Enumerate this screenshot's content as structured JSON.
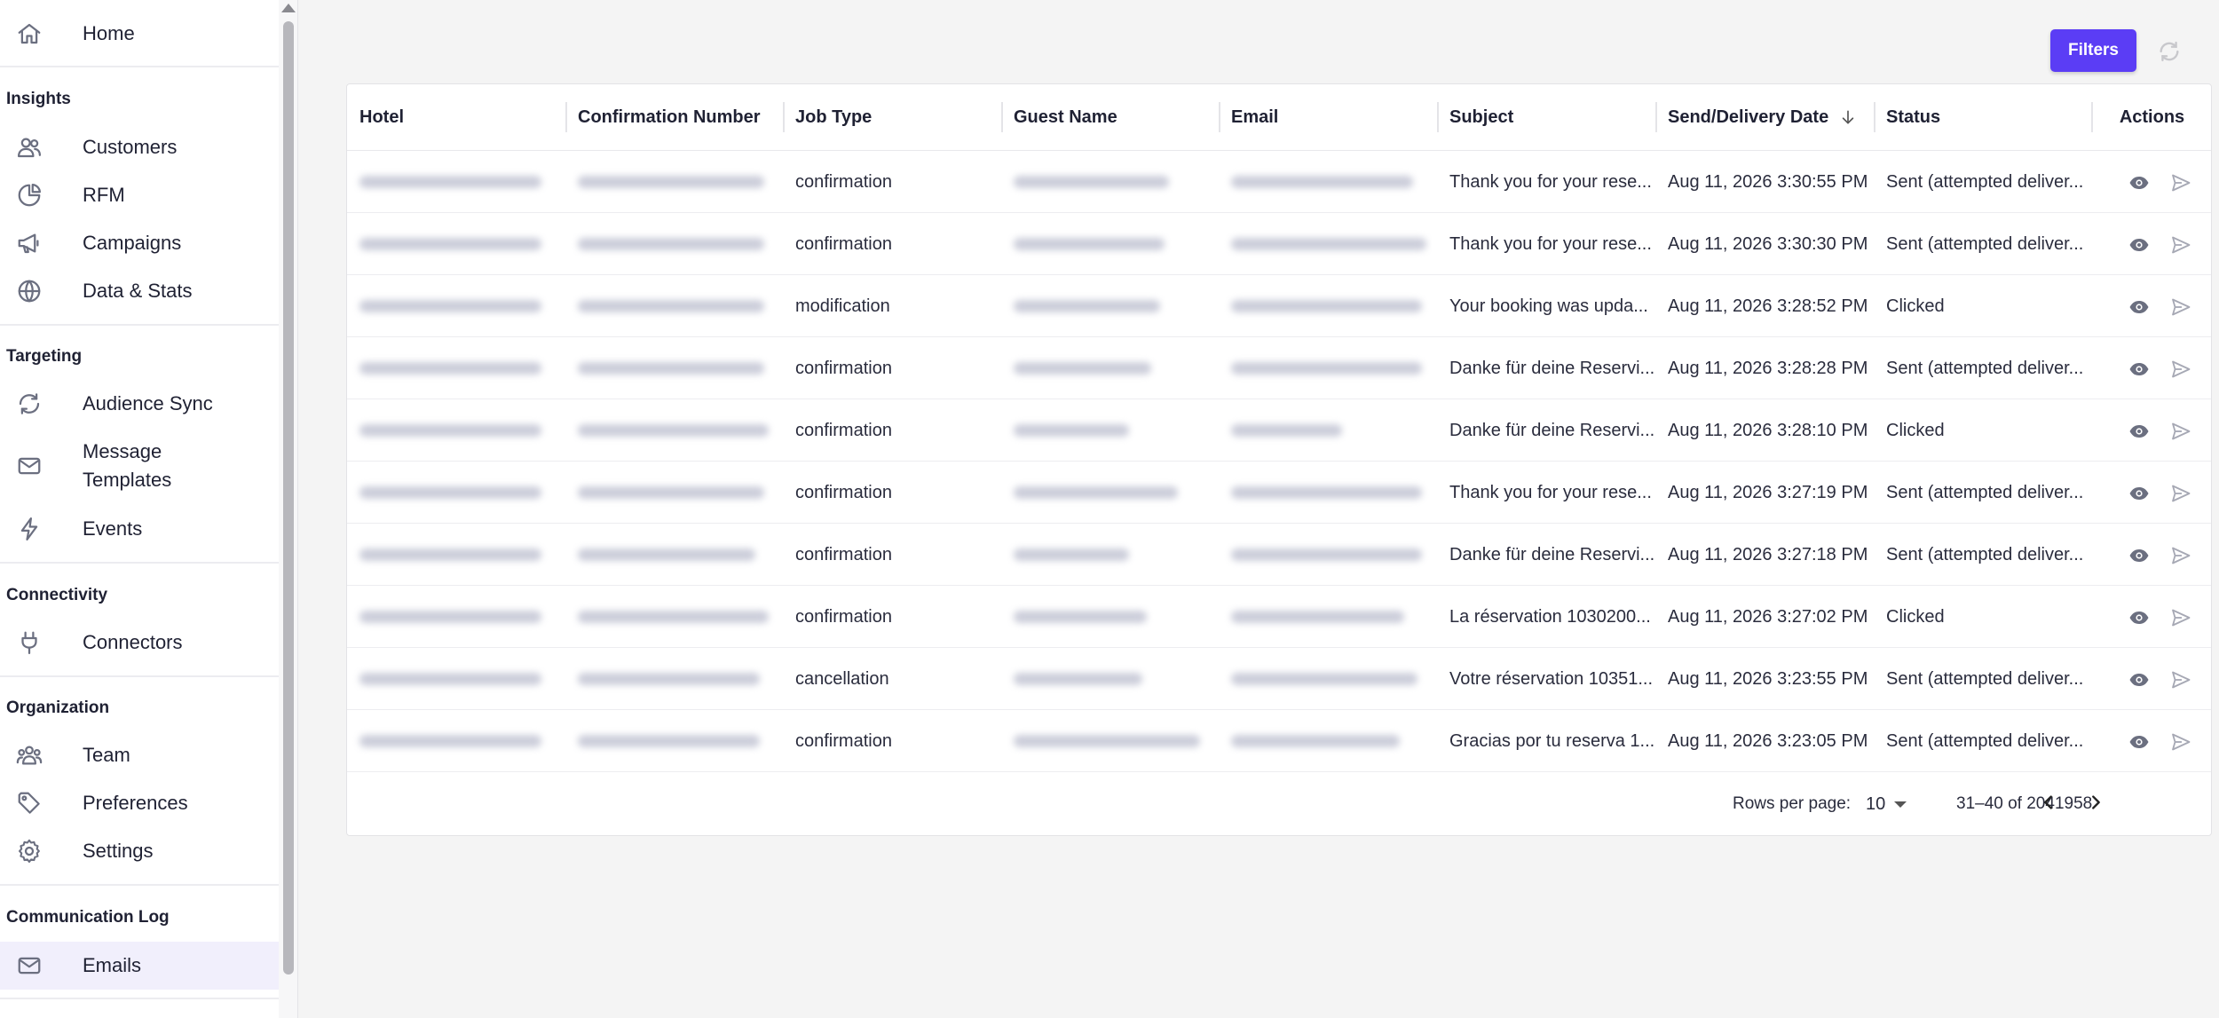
{
  "sidebar": {
    "home": "Home",
    "sections": {
      "insights": "Insights",
      "targeting": "Targeting",
      "connectivity": "Connectivity",
      "organization": "Organization",
      "communication_log": "Communication Log"
    },
    "items": {
      "customers": "Customers",
      "rfm": "RFM",
      "campaigns": "Campaigns",
      "data_stats": "Data & Stats",
      "audience_sync": "Audience Sync",
      "message_templates": "Message Templates",
      "events": "Events",
      "connectors": "Connectors",
      "team": "Team",
      "preferences": "Preferences",
      "settings": "Settings",
      "emails": "Emails"
    },
    "active_item": "Emails"
  },
  "toolbar": {
    "filters_label": "Filters",
    "refresh_icon": "refresh-icon"
  },
  "table": {
    "columns": {
      "hotel": "Hotel",
      "confirmation_number": "Confirmation Number",
      "job_type": "Job Type",
      "guest_name": "Guest Name",
      "email": "Email",
      "subject": "Subject",
      "send_delivery_date": "Send/Delivery Date",
      "status": "Status",
      "actions": "Actions"
    },
    "sorted_column": "Send/Delivery Date",
    "sort_direction": "descending",
    "rows": [
      {
        "job_type": "confirmation",
        "subject": "Thank you for your rese...",
        "date": "Aug 11, 2026 3:30:55 PM",
        "status": "Sent (attempted deliver..."
      },
      {
        "job_type": "confirmation",
        "subject": "Thank you for your rese...",
        "date": "Aug 11, 2026 3:30:30 PM",
        "status": "Sent (attempted deliver..."
      },
      {
        "job_type": "modification",
        "subject": "Your booking was upda...",
        "date": "Aug 11, 2026 3:28:52 PM",
        "status": "Clicked"
      },
      {
        "job_type": "confirmation",
        "subject": "Danke für deine Reservi...",
        "date": "Aug 11, 2026 3:28:28 PM",
        "status": "Sent (attempted deliver..."
      },
      {
        "job_type": "confirmation",
        "subject": "Danke für deine Reservi...",
        "date": "Aug 11, 2026 3:28:10 PM",
        "status": "Clicked"
      },
      {
        "job_type": "confirmation",
        "subject": "Thank you for your rese...",
        "date": "Aug 11, 2026 3:27:19 PM",
        "status": "Sent (attempted deliver..."
      },
      {
        "job_type": "confirmation",
        "subject": "Danke für deine Reservi...",
        "date": "Aug 11, 2026 3:27:18 PM",
        "status": "Sent (attempted deliver..."
      },
      {
        "job_type": "confirmation",
        "subject": "La réservation 1030200...",
        "date": "Aug 11, 2026 3:27:02 PM",
        "status": "Clicked"
      },
      {
        "job_type": "cancellation",
        "subject": "Votre réservation 10351...",
        "date": "Aug 11, 2026 3:23:55 PM",
        "status": "Sent (attempted deliver..."
      },
      {
        "job_type": "confirmation",
        "subject": "Gracias por tu reserva 1...",
        "date": "Aug 11, 2026 3:23:05 PM",
        "status": "Sent (attempted deliver..."
      }
    ],
    "row_actions": [
      "eye-icon",
      "send-icon"
    ]
  },
  "pagination": {
    "rows_per_page_label": "Rows per page:",
    "rows_per_page": "10",
    "range": "31–40 of 2041958"
  },
  "colors": {
    "accent": "#5b3df5",
    "active_nav_bg": "#f1effc"
  }
}
